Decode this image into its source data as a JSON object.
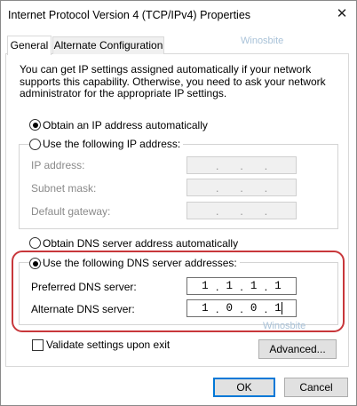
{
  "window": {
    "title": "Internet Protocol Version 4 (TCP/IPv4) Properties",
    "close_glyph": "✕"
  },
  "watermark": "Winosbite",
  "tabs": [
    {
      "label": "General",
      "active": true
    },
    {
      "label": "Alternate Configuration",
      "active": false
    }
  ],
  "general": {
    "description": "You can get IP settings assigned automatically if your network supports this capability. Otherwise, you need to ask your network administrator for the appropriate IP settings.",
    "ip_mode": {
      "auto_label": "Obtain an IP address automatically",
      "manual_label": "Use the following IP address:",
      "selected": "auto"
    },
    "ip_fields": [
      {
        "label": "IP address:",
        "octets": [
          "",
          "",
          "",
          ""
        ]
      },
      {
        "label": "Subnet mask:",
        "octets": [
          "",
          "",
          "",
          ""
        ]
      },
      {
        "label": "Default gateway:",
        "octets": [
          "",
          "",
          "",
          ""
        ]
      }
    ],
    "dns_mode": {
      "auto_label": "Obtain DNS server address automatically",
      "manual_label": "Use the following DNS server addresses:",
      "selected": "manual"
    },
    "dns_fields": [
      {
        "label": "Preferred DNS server:",
        "octets": [
          "1",
          "1",
          "1",
          "1"
        ]
      },
      {
        "label": "Alternate DNS server:",
        "octets": [
          "1",
          "0",
          "0",
          "1"
        ]
      }
    ],
    "validate_label": "Validate settings upon exit",
    "validate_checked": false,
    "advanced_label": "Advanced..."
  },
  "buttons": {
    "ok": "OK",
    "cancel": "Cancel"
  },
  "colors": {
    "accent": "#0078d7",
    "highlight_ring": "#c8373b",
    "watermark": "#a9c2d8"
  }
}
